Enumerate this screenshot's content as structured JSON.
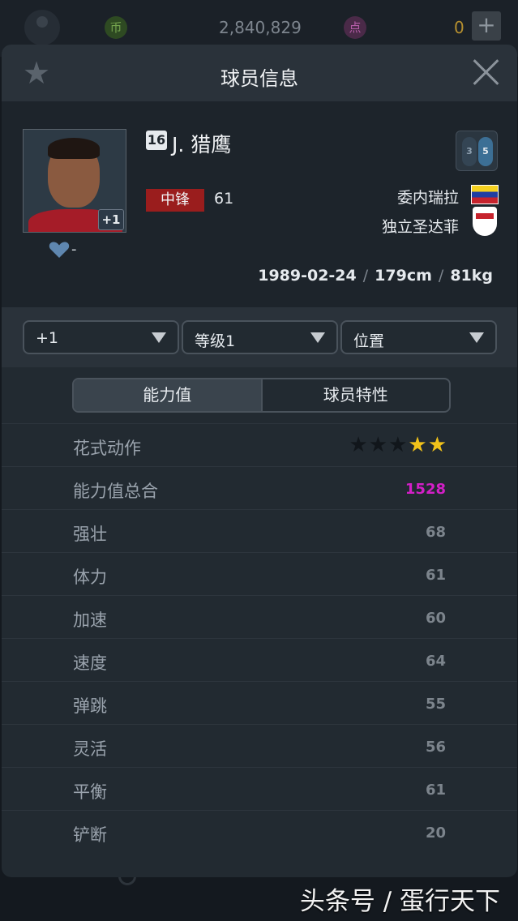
{
  "topbar": {
    "coin_icon": "币",
    "coins": "2,840,829",
    "point_icon": "点",
    "points": "0",
    "add_label": "+"
  },
  "dialog": {
    "title": "球员信息"
  },
  "player": {
    "number": "16",
    "name": "J. 猎鹰",
    "photo_badge": "+1",
    "favorites": "-",
    "position": "中锋",
    "rating": "61",
    "boots_left": "3",
    "boots_right": "5",
    "nationality": "委内瑞拉",
    "club": "独立圣达菲",
    "birth_date": "1989-02-24",
    "height": "179cm",
    "weight": "81kg",
    "separator": "/"
  },
  "filters": {
    "enhance": "+1",
    "level": "等级1",
    "position": "位置"
  },
  "tabs": {
    "stats": "能力值",
    "traits": "球员特性"
  },
  "stats": {
    "skill_moves_label": "花式动作",
    "skill_moves_stars": 2,
    "skill_moves_max": 5,
    "total_label": "能力值总合",
    "total_value": "1528",
    "rows": [
      {
        "label": "强壮",
        "value": "68"
      },
      {
        "label": "体力",
        "value": "61"
      },
      {
        "label": "加速",
        "value": "60"
      },
      {
        "label": "速度",
        "value": "64"
      },
      {
        "label": "弹跳",
        "value": "55"
      },
      {
        "label": "灵活",
        "value": "56"
      },
      {
        "label": "平衡",
        "value": "61"
      },
      {
        "label": "铲断",
        "value": "20"
      }
    ]
  },
  "watermark": "头条号 / 蛋行天下",
  "colors": {
    "total_value": "#d31fc7",
    "position_badge": "#9a1d1d",
    "star_full": "#f1c21a"
  }
}
